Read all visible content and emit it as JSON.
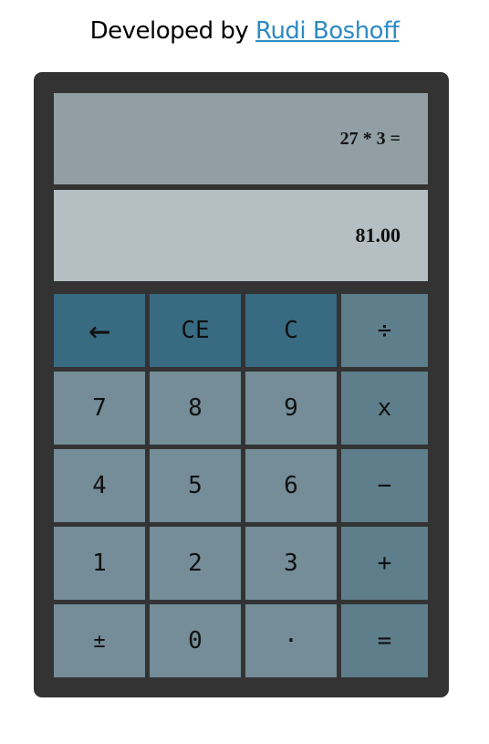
{
  "header": {
    "prefix": "Developed by ",
    "author_link": "Rudi Boshoff"
  },
  "display": {
    "expression": "27 * 3 =",
    "result": "81.00"
  },
  "keys": {
    "backspace": "←",
    "clear_entry": "CE",
    "clear": "C",
    "divide": "÷",
    "seven": "7",
    "eight": "8",
    "nine": "9",
    "multiply": "x",
    "four": "4",
    "five": "5",
    "six": "6",
    "subtract": "−",
    "one": "1",
    "two": "2",
    "three": "3",
    "add": "+",
    "negate": "±",
    "zero": "0",
    "decimal": "·",
    "equals": "="
  },
  "colors": {
    "frame": "#333333",
    "expression_screen": "#919fa5",
    "result_screen": "#b4bec3",
    "number_key": "#748d98",
    "operator_key": "#5e7e8b",
    "function_key": "#386a82",
    "link": "#2d8bc4"
  }
}
